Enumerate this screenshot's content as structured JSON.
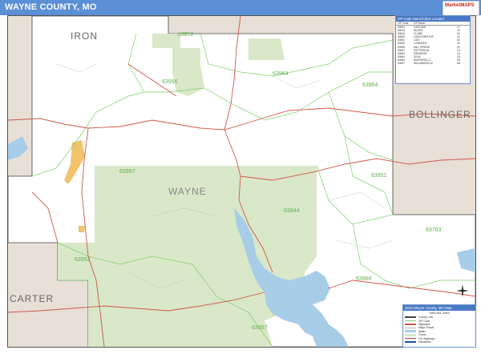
{
  "header": {
    "title": "WAYNE COUNTY, MO",
    "logo_text": "MarketMAPS"
  },
  "map": {
    "county_label": "WAYNE",
    "neighbor_counties": [
      "IRON",
      "BOLLINGER",
      "CARTER"
    ],
    "zip_labels": [
      "63950",
      "63956",
      "63964",
      "63964",
      "63957",
      "63944",
      "63951",
      "63763",
      "63952",
      "63966",
      "63957"
    ],
    "colors": {
      "forest": "#d9e8c8",
      "outside": "#e8dfd6",
      "water": "#a8cde8",
      "road": "#d0574a",
      "zip_line": "#7fcf6d",
      "town": "#f2c36b"
    }
  },
  "zip_table": {
    "title": "ZIP Code Name/Cities Located",
    "columns": [
      "ZIP Code",
      "ZIP Name",
      ""
    ],
    "rows": [
      [
        "63934",
        "CASCADE",
        "17"
      ],
      [
        "63944",
        "MCGEE",
        "15"
      ],
      [
        "63944",
        "CLUBB",
        "16"
      ],
      [
        "63950",
        "LODI/CHRISTOP",
        "14"
      ],
      [
        "63951",
        "LODI",
        "61"
      ],
      [
        "63952",
        "LOWNDES",
        "28"
      ],
      [
        "63956",
        "MILL SPRING",
        "33"
      ],
      [
        "63957",
        "PATTERSON",
        "C3"
      ],
      [
        "63964",
        "PIEDMONT",
        "C4"
      ],
      [
        "63964",
        "SILVA",
        "C5"
      ],
      [
        "63966",
        "WAPPAPELLO",
        "D5"
      ],
      [
        "63967",
        "WILLIAMSVILLE",
        "D6"
      ]
    ]
  },
  "legend": {
    "title": "2016 Wayne County, MO Map",
    "subtitle": "Cities and Towns",
    "items": [
      "County Line",
      "ZIP Code",
      "Highways",
      "Major Roads",
      "Water",
      "Forest",
      "US Highways",
      "Interstates"
    ]
  }
}
